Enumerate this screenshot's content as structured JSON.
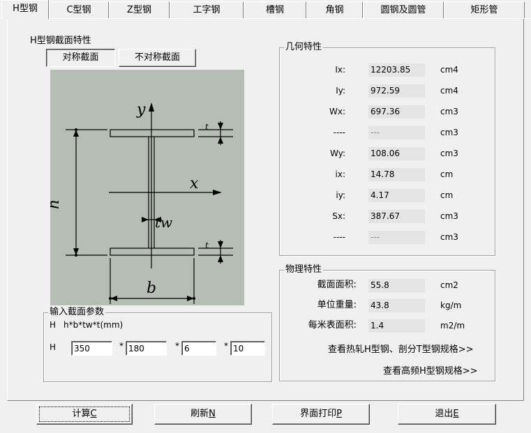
{
  "tabs": [
    "H型钢",
    "C型钢",
    "Z型钢",
    "工字钢",
    "槽钢",
    "角钢",
    "圆钢及圆管",
    "矩形管"
  ],
  "section_group": {
    "title": "H型钢截面特性",
    "btn_symmetric": "对称截面",
    "btn_asymmetric": "不对称截面"
  },
  "diagram": {
    "y_label": "y",
    "x_label": "x",
    "h_label": "h",
    "b_label": "b",
    "tw_label": "tw",
    "t_label": "t",
    "bg_color": "#b5bdb4"
  },
  "geometry": {
    "title": "几何特性",
    "rows": [
      {
        "label": "Ix:",
        "value": "12203.85",
        "unit": "cm4"
      },
      {
        "label": "Iy:",
        "value": "972.59",
        "unit": "cm4"
      },
      {
        "label": "Wx:",
        "value": "697.36",
        "unit": "cm3"
      },
      {
        "label": "----",
        "value": "---",
        "unit": "cm3"
      },
      {
        "label": "Wy:",
        "value": "108.06",
        "unit": "cm3"
      },
      {
        "label": "ix:",
        "value": "14.78",
        "unit": "cm"
      },
      {
        "label": "iy:",
        "value": "4.17",
        "unit": "cm"
      },
      {
        "label": "Sx:",
        "value": "387.67",
        "unit": "cm3"
      },
      {
        "label": "----",
        "value": "---",
        "unit": "cm3"
      }
    ]
  },
  "physical": {
    "title": "物理特性",
    "rows": [
      {
        "label": "截面面积:",
        "value": "55.8",
        "unit": "cm2"
      },
      {
        "label": "单位重量:",
        "value": "43.8",
        "unit": "kg/m"
      },
      {
        "label": "每米表面积:",
        "value": "1.4",
        "unit": "m2/m"
      }
    ],
    "link_hot_rolled": "查看热轧H型钢、剖分T型钢规格>>",
    "link_high_freq": "查看高频H型钢规格>>"
  },
  "params": {
    "title": "输入截面参数",
    "formula_prefix": "H",
    "formula": "h*b*tw*t(mm)",
    "row_prefix": "H",
    "sep": "*",
    "h": "350",
    "b": "180",
    "tw": "6",
    "t": "10"
  },
  "buttons": {
    "calc": "计算",
    "calc_key": "C",
    "refresh": "刷新",
    "refresh_key": "N",
    "print": "界面打印",
    "print_key": "P",
    "exit": "退出",
    "exit_key": "E"
  }
}
